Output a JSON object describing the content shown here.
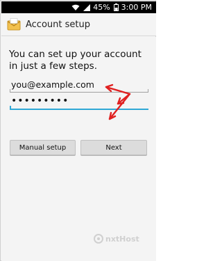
{
  "status_bar": {
    "battery": "45%",
    "time": "3:00 PM",
    "icons": [
      "wifi-icon",
      "signal-icon",
      "battery-icon"
    ]
  },
  "action_bar": {
    "title": "Account setup",
    "icon": "email-envelope-icon"
  },
  "form": {
    "intro": "You can set up your account in just a few steps.",
    "email_value": "you@example.com",
    "password_value": "•••••••••",
    "password_placeholder": ""
  },
  "buttons": {
    "manual_setup": "Manual setup",
    "next": "Next"
  },
  "watermark": {
    "text": "nxtHost",
    "icon": "logo-icon"
  },
  "colors": {
    "accent": "#2fa8d6",
    "annotation_arrow": "#e02020",
    "status_bar_bg": "#000000",
    "background": "#f4f4f4"
  }
}
